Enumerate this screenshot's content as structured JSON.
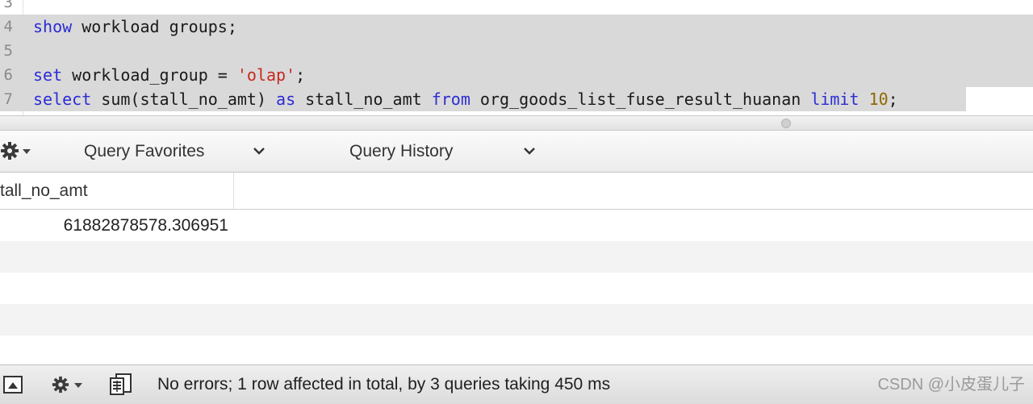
{
  "editor": {
    "lines": [
      {
        "n": "3"
      },
      {
        "n": "4",
        "tokens": [
          [
            "kw",
            "show"
          ],
          [
            "t",
            " workload groups;"
          ]
        ]
      },
      {
        "n": "5"
      },
      {
        "n": "6",
        "tokens": [
          [
            "kw",
            "set"
          ],
          [
            "t",
            " workload_group = "
          ],
          [
            "str",
            "'olap'"
          ],
          [
            "t",
            ";"
          ]
        ]
      },
      {
        "n": "7",
        "tokens": [
          [
            "kw",
            "select"
          ],
          [
            "t",
            " sum(stall_no_amt) "
          ],
          [
            "kw",
            "as"
          ],
          [
            "t",
            " stall_no_amt "
          ],
          [
            "kw",
            "from"
          ],
          [
            "t",
            " org_goods_list_fuse_result_huanan "
          ],
          [
            "kw",
            "limit"
          ],
          [
            "t",
            " "
          ],
          [
            "num",
            "10"
          ],
          [
            "t",
            ";"
          ]
        ]
      }
    ]
  },
  "toolbar": {
    "gear_icon": "gear-icon",
    "favorites_label": "Query Favorites",
    "history_label": "Query History"
  },
  "results": {
    "column_header": "tall_no_amt",
    "rows": [
      "61882878578.306951"
    ]
  },
  "statusbar": {
    "message": "No errors; 1 row affected in total, by 3 queries taking 450 ms",
    "watermark": "CSDN @小皮蛋儿子"
  },
  "colors": {
    "keyword": "#2c2cd4",
    "string": "#c62a20",
    "number": "#8f6a00",
    "selection": "#d9d9d9"
  }
}
